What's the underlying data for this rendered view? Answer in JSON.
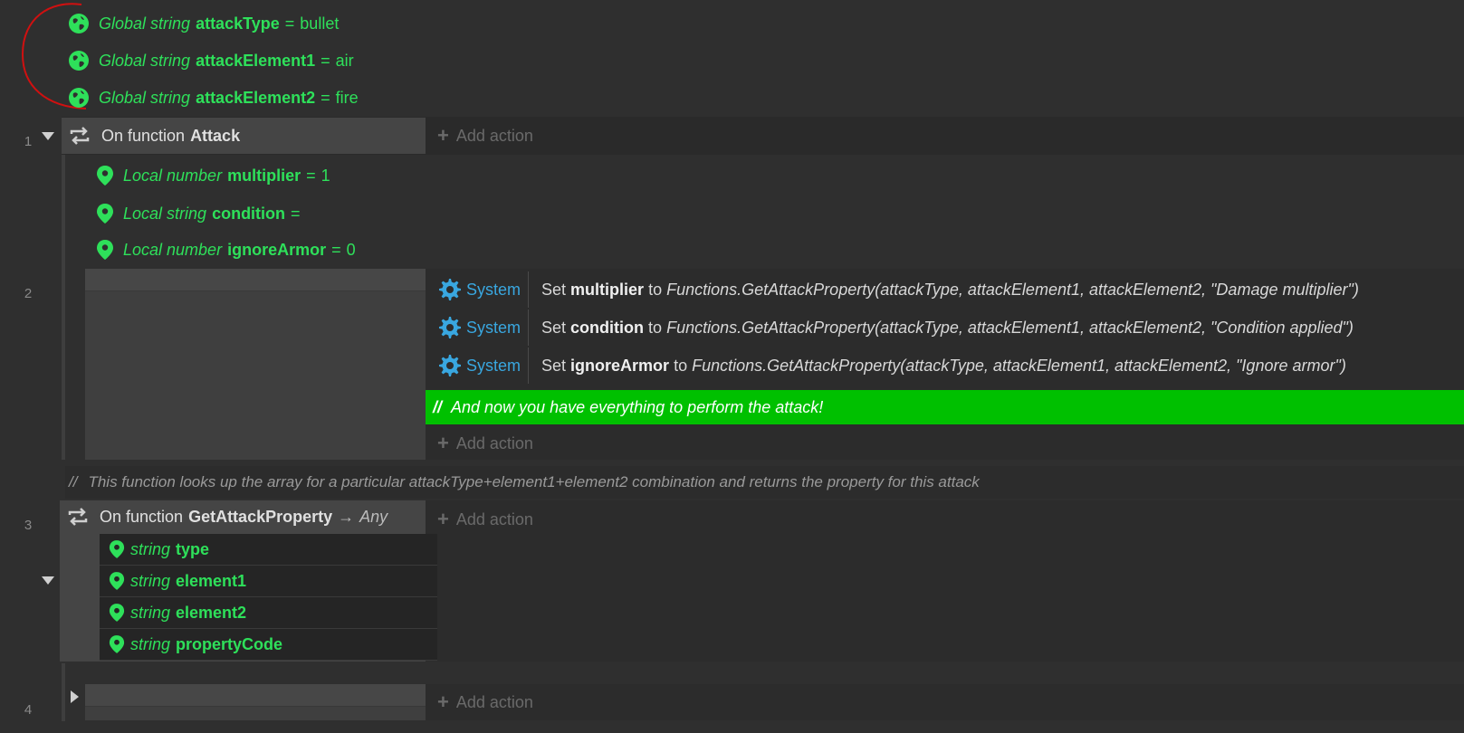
{
  "globals": [
    {
      "scope": "Global string",
      "name": "attackType",
      "eq": "=",
      "value": "bullet"
    },
    {
      "scope": "Global string",
      "name": "attackElement1",
      "eq": "=",
      "value": "air"
    },
    {
      "scope": "Global string",
      "name": "attackElement2",
      "eq": "=",
      "value": "fire"
    }
  ],
  "events": {
    "e1": {
      "line": "1",
      "prefix": "On function",
      "name": "Attack",
      "add_action": "Add action"
    },
    "e2": {
      "line": "2",
      "add_action": "Add action"
    },
    "e3": {
      "line": "3",
      "prefix": "On function",
      "name": "GetAttackProperty",
      "arrow": "→",
      "ret": "Any",
      "add_action": "Add action"
    },
    "e4": {
      "line": "4",
      "add_action": "Add action"
    }
  },
  "locals": [
    {
      "scope": "Local number",
      "name": "multiplier",
      "eq": "=",
      "value": "1"
    },
    {
      "scope": "Local string",
      "name": "condition",
      "eq": "=",
      "value": ""
    },
    {
      "scope": "Local number",
      "name": "ignoreArmor",
      "eq": "=",
      "value": "0"
    }
  ],
  "actions": [
    {
      "object": "System",
      "set": "Set",
      "var": "multiplier",
      "to": "to",
      "expr": "Functions.GetAttackProperty(attackType, attackElement1, attackElement2, \"Damage multiplier\")"
    },
    {
      "object": "System",
      "set": "Set",
      "var": "condition",
      "to": "to",
      "expr": "Functions.GetAttackProperty(attackType, attackElement1, attackElement2, \"Condition applied\")"
    },
    {
      "object": "System",
      "set": "Set",
      "var": "ignoreArmor",
      "to": "to",
      "expr": "Functions.GetAttackProperty(attackType, attackElement1, attackElement2, \"Ignore armor\")"
    }
  ],
  "comments": {
    "green": {
      "slashes": "//",
      "text": "And now you have everything to perform the attack!"
    },
    "plain": {
      "slashes": "//",
      "text": "This function looks up the array for a particular attackType+element1+element2 combination and returns the property for this attack"
    }
  },
  "params": [
    {
      "type": "string",
      "name": "type"
    },
    {
      "type": "string",
      "name": "element1"
    },
    {
      "type": "string",
      "name": "element2"
    },
    {
      "type": "string",
      "name": "propertyCode"
    }
  ],
  "colors": {
    "background": "#2f2f2f",
    "variable_green": "#2ee05a",
    "comment_green": "#00c000",
    "system_blue": "#39a7e0",
    "annotation_red": "#d01010"
  }
}
